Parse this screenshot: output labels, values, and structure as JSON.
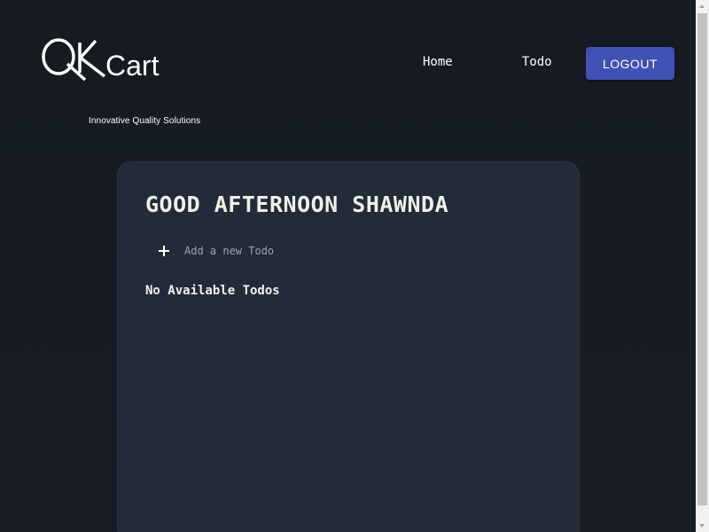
{
  "header": {
    "logo": {
      "brand_mark": "QK",
      "brand_name": "Cart",
      "tagline": "Innovative Quality Solutions"
    },
    "nav": {
      "home_label": "Home",
      "todo_label": "Todo"
    },
    "logout_label": "LOGOUT"
  },
  "main": {
    "greeting": "GOOD AFTERNOON SHAWNDA",
    "add_todo": {
      "placeholder": "Add a new Todo",
      "value": ""
    },
    "empty_message": "No Available Todos"
  },
  "colors": {
    "background": "#161b22",
    "card": "#222b37",
    "accent": "#3f51b5"
  },
  "icons": {
    "add": "plus-icon"
  }
}
